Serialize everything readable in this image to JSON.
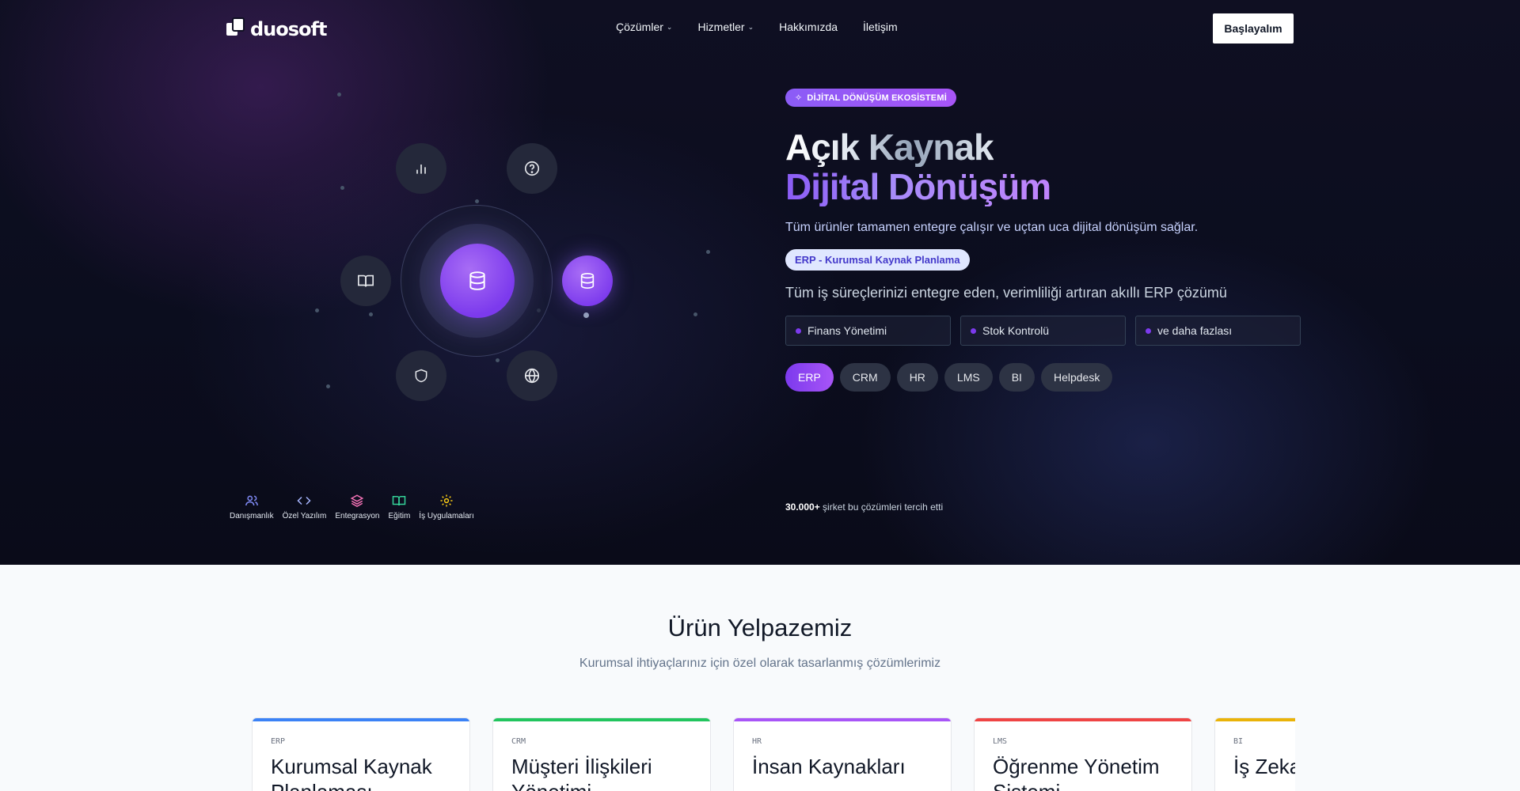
{
  "nav": {
    "logo_text": "duosoft",
    "menu": [
      {
        "label": "Çözümler",
        "has_dropdown": true
      },
      {
        "label": "Hizmetler",
        "has_dropdown": true
      },
      {
        "label": "Hakkımızda",
        "has_dropdown": false
      },
      {
        "label": "İletişim",
        "has_dropdown": false
      }
    ],
    "cta_label": "Başlayalım"
  },
  "orbit": {
    "nodes": [
      "bar-chart-icon",
      "help-circle-icon",
      "book-icon",
      "database-icon",
      "shield-icon",
      "globe-icon"
    ],
    "core_icon": "database-icon"
  },
  "services": [
    {
      "label": "Danışmanlık",
      "icon": "users-icon",
      "color": "#818cf8"
    },
    {
      "label": "Özel Yazılım",
      "icon": "code-icon",
      "color": "#a5b4fc"
    },
    {
      "label": "Entegrasyon",
      "icon": "layers-icon",
      "color": "#f472b6"
    },
    {
      "label": "Eğitim",
      "icon": "book-open-icon",
      "color": "#34d399"
    },
    {
      "label": "İş Uygulamaları",
      "icon": "gear-icon",
      "color": "#facc15"
    }
  ],
  "hero": {
    "badge": "DİJİTAL DÖNÜŞÜM EKOSİSTEMİ",
    "title_line1": "Açık Kaynak",
    "title_line2": "Dijital Dönüşüm",
    "lead": "Tüm ürünler tamamen entegre çalışır ve uçtan uca dijital dönüşüm sağlar.",
    "product_pill": "ERP - Kurumsal Kaynak Planlama",
    "product_desc": "Tüm iş süreçlerinizi entegre eden, verimliliği artıran akıllı ERP çözümü",
    "features": [
      "Finans Yönetimi",
      "Stok Kontrolü",
      "ve daha fazlası"
    ],
    "tabs": [
      "ERP",
      "CRM",
      "HR",
      "LMS",
      "BI",
      "Helpdesk"
    ],
    "active_tab": "ERP",
    "proof_count": "30.000+",
    "proof_text": " şirket bu çözümleri tercih etti"
  },
  "products": {
    "title": "Ürün Yelpazemiz",
    "subtitle": "Kurumsal ihtiyaçlarınız için özel olarak tasarlanmış çözümlerimiz",
    "cards": [
      {
        "tag": "ERP",
        "title": "Kurumsal Kaynak Planlaması",
        "color": "#3b82f6"
      },
      {
        "tag": "CRM",
        "title": "Müşteri İlişkileri Yönetimi",
        "color": "#22c55e"
      },
      {
        "tag": "HR",
        "title": "İnsan Kaynakları",
        "color": "#a855f7"
      },
      {
        "tag": "LMS",
        "title": "Öğrenme Yönetim Sistemi",
        "color": "#ef4444"
      },
      {
        "tag": "BI",
        "title": "İş Zekası",
        "color": "#eab308"
      }
    ]
  }
}
